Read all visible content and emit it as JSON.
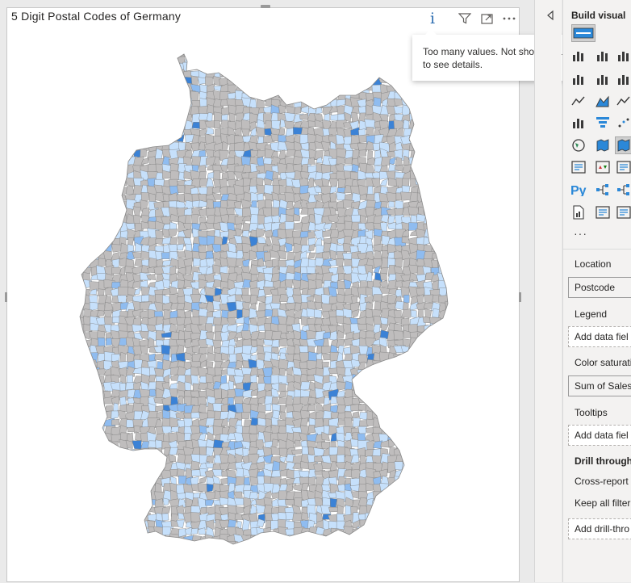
{
  "visual": {
    "title": "5 Digit Postal Codes of Germany",
    "tooltip": "Too many values. Not showing all data. Click to see details."
  },
  "header_icons": [
    "info-icon",
    "filter-icon",
    "focus-mode-icon",
    "more-options-icon"
  ],
  "pane": {
    "title": "Build visual",
    "wells": {
      "location_label": "Location",
      "location_value": "Postcode",
      "legend_label": "Legend",
      "legend_placeholder": "Add data fiel",
      "color_label": "Color saturati",
      "color_value": "Sum of Sales",
      "tooltips_label": "Tooltips",
      "tooltips_placeholder": "Add data fiel",
      "drill_label": "Drill through",
      "cross_report": "Cross-report",
      "keep_filters": "Keep all filter",
      "drill_placeholder": "Add drill-thro"
    },
    "more": "···"
  },
  "colors": {
    "map_gray": "#bfbdbd",
    "map_light_blue": "#c6e0fb",
    "map_mid_blue": "#8fbcf0",
    "map_dark_blue": "#3b82d6",
    "accent": "#2b6cb0"
  }
}
